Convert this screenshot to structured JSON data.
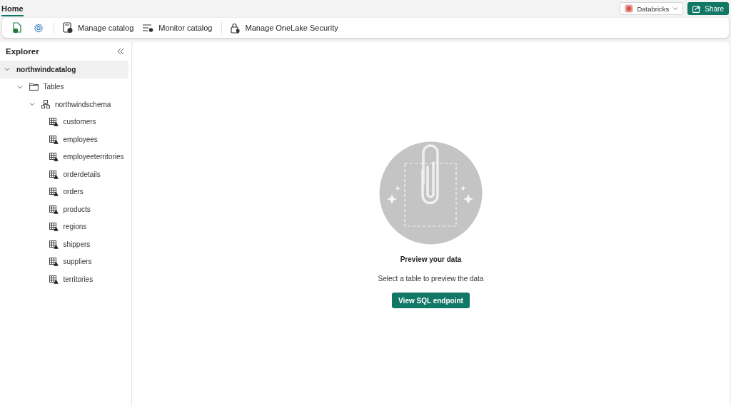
{
  "tabs": [
    {
      "label": "Home",
      "selected": true
    }
  ],
  "workspace": {
    "label": "Databricks"
  },
  "share": {
    "label": "Share"
  },
  "toolbar": [
    {
      "items": [
        {
          "kind": "icon"
        },
        {
          "kind": "icon"
        }
      ]
    },
    {
      "items": [
        {
          "label": "Manage catalog",
          "kind": "text"
        },
        {
          "label": "Monitor catalog",
          "kind": "text"
        }
      ]
    },
    {
      "items": [
        {
          "label": "Manage OneLake Security",
          "kind": "text"
        }
      ]
    }
  ],
  "explorer": {
    "title": "Explorer",
    "tree": [
      {
        "label": "northwindcatalog",
        "expanded": true,
        "selected": true,
        "children": [
          {
            "label": "Tables",
            "kind": "folder",
            "expanded": true,
            "selected": false,
            "children": [
              {
                "label": "northwindschema",
                "kind": "schema",
                "expanded": true,
                "selected": false,
                "children": [
                  {
                    "label": "customers",
                    "kind": "table",
                    "selected": false
                  },
                  {
                    "label": "employees",
                    "kind": "table",
                    "selected": false
                  },
                  {
                    "label": "employeeterritories",
                    "kind": "table",
                    "selected": false
                  },
                  {
                    "label": "orderdetails",
                    "kind": "table",
                    "selected": false
                  },
                  {
                    "label": "orders",
                    "kind": "table",
                    "selected": false
                  },
                  {
                    "label": "products",
                    "kind": "table",
                    "selected": false
                  },
                  {
                    "label": "regions",
                    "kind": "table",
                    "selected": false
                  },
                  {
                    "label": "shippers",
                    "kind": "table",
                    "selected": false
                  },
                  {
                    "label": "suppliers",
                    "kind": "table",
                    "selected": false
                  },
                  {
                    "label": "territories",
                    "kind": "table",
                    "selected": false
                  }
                ]
              }
            ]
          }
        ]
      }
    ]
  },
  "empty_state": {
    "title": "Preview your data",
    "message": "Select a table to preview the data",
    "button": "View SQL endpoint"
  }
}
